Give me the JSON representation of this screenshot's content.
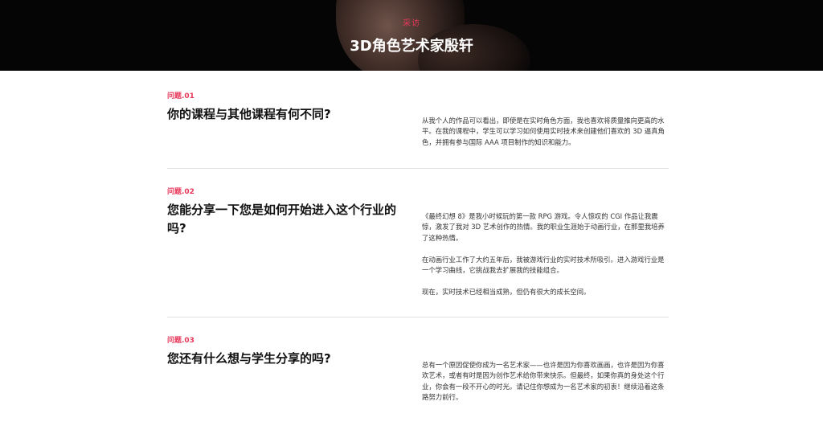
{
  "header": {
    "kicker": "采访",
    "title": "3D角色艺术家殷轩"
  },
  "qa": [
    {
      "number": "问题.01",
      "question": "你的课程与其他课程有何不同?",
      "answer": [
        "从我个人的作品可以看出，即使是在实时角色方面，我也喜欢将质量推向更高的水平。在我的课程中，学生可以学习如何使用实时技术来创建他们喜欢的 3D 逼真角色，并拥有参与国际 AAA 项目制作的知识和能力。"
      ]
    },
    {
      "number": "问题.02",
      "question": "您能分享一下您是如何开始进入这个行业的吗?",
      "answer": [
        "《最终幻想 8》是我小时候玩的第一款 RPG 游戏。令人惊叹的 CGI 作品让我震惊，激发了我对 3D 艺术创作的热情。我的职业生涯始于动画行业，在那里我培养了这种热情。",
        "在动画行业工作了大约五年后，我被游戏行业的实时技术所吸引。进入游戏行业是一个学习曲线，它挑战我去扩展我的技能组合。",
        "现在，实时技术已经相当成熟，但仍有很大的成长空间。"
      ]
    },
    {
      "number": "问题.03",
      "question": "您还有什么想与学生分享的吗?",
      "answer": [
        "总有一个原因促使你成为一名艺术家——也许是因为你喜欢画画，也许是因为你喜欢艺术，或者有时是因为创作艺术给你带来快乐。但最终，如果你真的身处这个行业，你会有一段不开心的时光。请记住你想成为一名艺术家的初衷！继续沿着这条路努力前行。"
      ]
    }
  ]
}
